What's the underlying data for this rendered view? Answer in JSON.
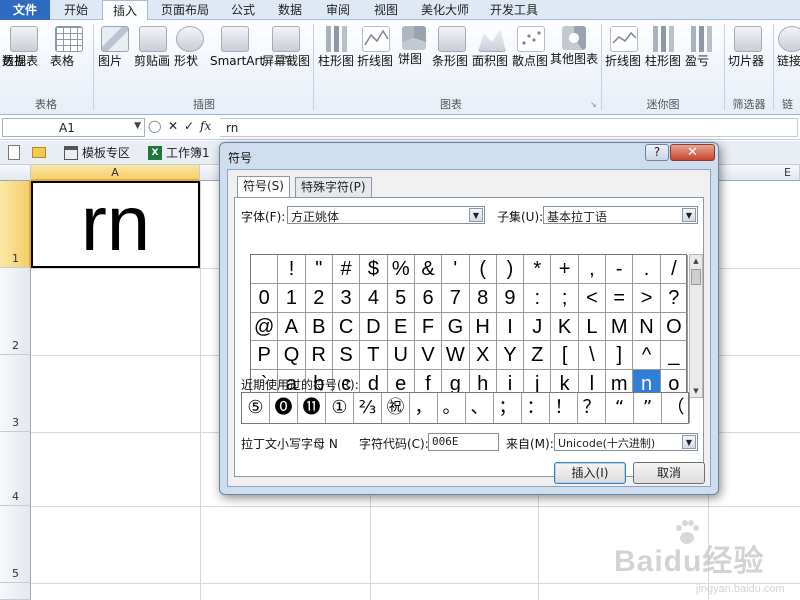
{
  "ribbon_tabs": [
    "文件",
    "开始",
    "插入",
    "页面布局",
    "公式",
    "数据",
    "审阅",
    "视图",
    "美化大师",
    "开发工具"
  ],
  "ribbon": {
    "buttons": {
      "pivot": "数据\n透视表",
      "pivot_line1": "数据",
      "pivot_line2": "透视表",
      "table": "表格",
      "picture": "图片",
      "clipart": "剪贴画",
      "shapes": "形状",
      "smartart": "SmartArt",
      "screenshot": "屏幕截图",
      "column": "柱形图",
      "line": "折线图",
      "pie": "饼图",
      "bar": "条形图",
      "area": "面积图",
      "scatter": "散点图",
      "other": "其他图表",
      "spark_line": "折线图",
      "spark_column": "柱形图",
      "spark_winloss": "盈亏",
      "slicer": "切片器",
      "link": "链接"
    },
    "groups": {
      "tables": "表格",
      "illustrations": "插图",
      "charts": "图表",
      "sparklines": "迷你图",
      "filter": "筛选器",
      "links": "链接"
    }
  },
  "formula_bar": {
    "name_box": "A1",
    "formula": "rn"
  },
  "doc_tabs": {
    "template": "模板专区",
    "workbook": "工作簿1"
  },
  "sheet": {
    "columns": [
      "A",
      "E"
    ],
    "rows": [
      "1",
      "2",
      "3",
      "4",
      "5"
    ],
    "a1_value": "rn"
  },
  "dialog": {
    "title": "符号",
    "help": "?",
    "close": "✕",
    "tab_symbols": "符号(S)",
    "tab_special": "特殊字符(P)",
    "font_label": "字体(F):",
    "font_value": "方正姚体",
    "subset_label": "子集(U):",
    "subset_value": "基本拉丁语",
    "grid_rows": [
      [
        " ",
        "!",
        "\"",
        "#",
        "$",
        "%",
        "&",
        "'",
        "(",
        ")",
        "*",
        "+",
        ",",
        "-",
        ".",
        "/"
      ],
      [
        "0",
        "1",
        "2",
        "3",
        "4",
        "5",
        "6",
        "7",
        "8",
        "9",
        ":",
        ";",
        "<",
        "=",
        ">",
        "?"
      ],
      [
        "@",
        "A",
        "B",
        "C",
        "D",
        "E",
        "F",
        "G",
        "H",
        "I",
        "J",
        "K",
        "L",
        "M",
        "N",
        "O"
      ],
      [
        "P",
        "Q",
        "R",
        "S",
        "T",
        "U",
        "V",
        "W",
        "X",
        "Y",
        "Z",
        "[",
        "\\",
        "]",
        "^",
        "_"
      ],
      [
        "`",
        "a",
        "b",
        "c",
        "d",
        "e",
        "f",
        "g",
        "h",
        "i",
        "j",
        "k",
        "l",
        "m",
        "n",
        "o"
      ]
    ],
    "selected_char": "n",
    "recent_label": "近期使用过的符号(R):",
    "recent": [
      "⑤",
      "⓿",
      "⓫",
      "①",
      "⅔",
      "㊗",
      "，",
      "。",
      "、",
      "；",
      "：",
      "！",
      "？",
      "“",
      "”",
      "（"
    ],
    "char_name": "拉丁文小写字母 N",
    "code_label": "字符代码(C):",
    "code_value": "006E",
    "from_label": "来自(M):",
    "from_value": "Unicode(十六进制)",
    "insert_button": "插入(I)",
    "cancel_button": "取消"
  },
  "watermark": {
    "brand": "Baidu经验",
    "url": "jingyan.baidu.com"
  },
  "colors": {
    "accent": "#2e6bc0",
    "selection": "#2f7fd9",
    "active_header": "#f6cf6a"
  }
}
